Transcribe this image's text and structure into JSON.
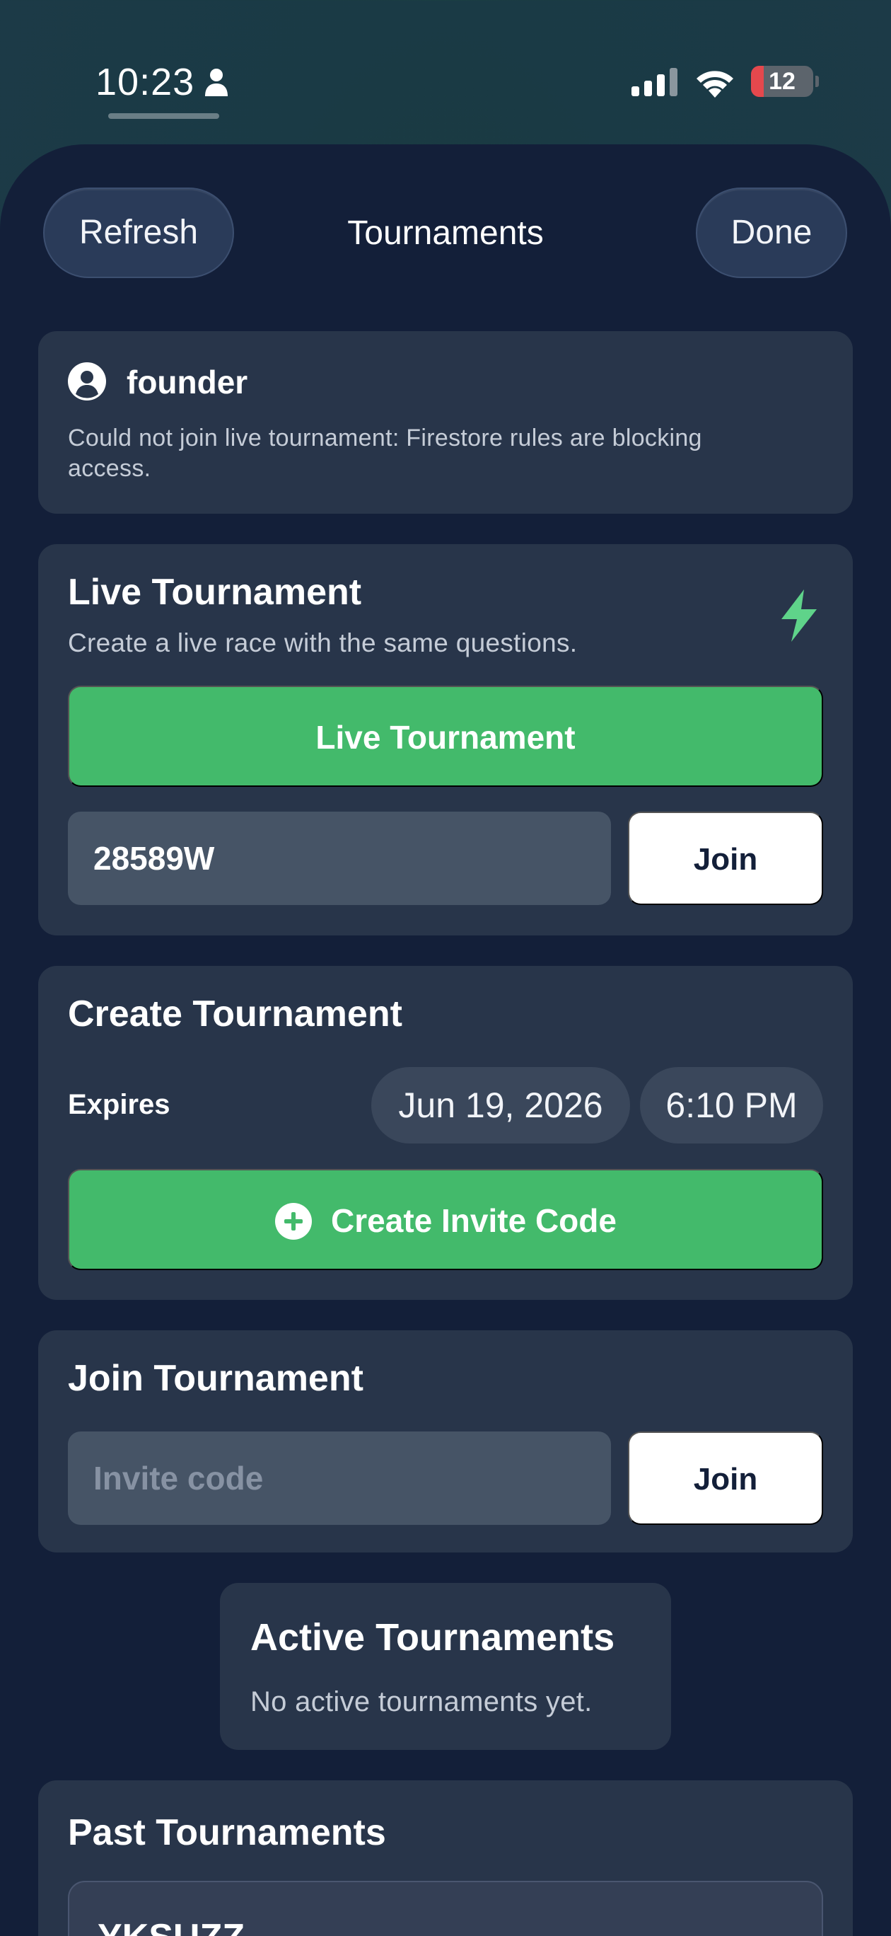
{
  "status_bar": {
    "time": "10:23",
    "battery_level": "12",
    "icons": [
      "person-icon",
      "signal-icon",
      "wifi-icon",
      "battery-icon"
    ]
  },
  "nav": {
    "refresh_label": "Refresh",
    "title": "Tournaments",
    "done_label": "Done"
  },
  "user_card": {
    "icon": "user-circle-icon",
    "username": "founder",
    "message": "Could not join live tournament: Firestore rules are blocking access."
  },
  "live_tournament": {
    "title": "Live Tournament",
    "subtitle": "Create a live race with the same questions.",
    "icon": "bolt-icon",
    "button_label": "Live Tournament",
    "code_value": "28589W",
    "join_label": "Join"
  },
  "create_tournament": {
    "title": "Create Tournament",
    "expires_label": "Expires",
    "date_value": "Jun 19, 2026",
    "time_value": "6:10 PM",
    "button_label": "Create Invite Code",
    "button_icon": "plus-circle-icon"
  },
  "join_tournament": {
    "title": "Join Tournament",
    "code_placeholder": "Invite code",
    "join_label": "Join"
  },
  "active_tournaments": {
    "title": "Active Tournaments",
    "empty_message": "No active tournaments yet."
  },
  "past_tournaments": {
    "title": "Past Tournaments",
    "items": [
      "YKSUZZ"
    ]
  },
  "colors": {
    "accent_green": "#43ba6b",
    "sheet_background": "#131f39",
    "card_background": "#28354a",
    "battery_low": "#e5484d"
  }
}
